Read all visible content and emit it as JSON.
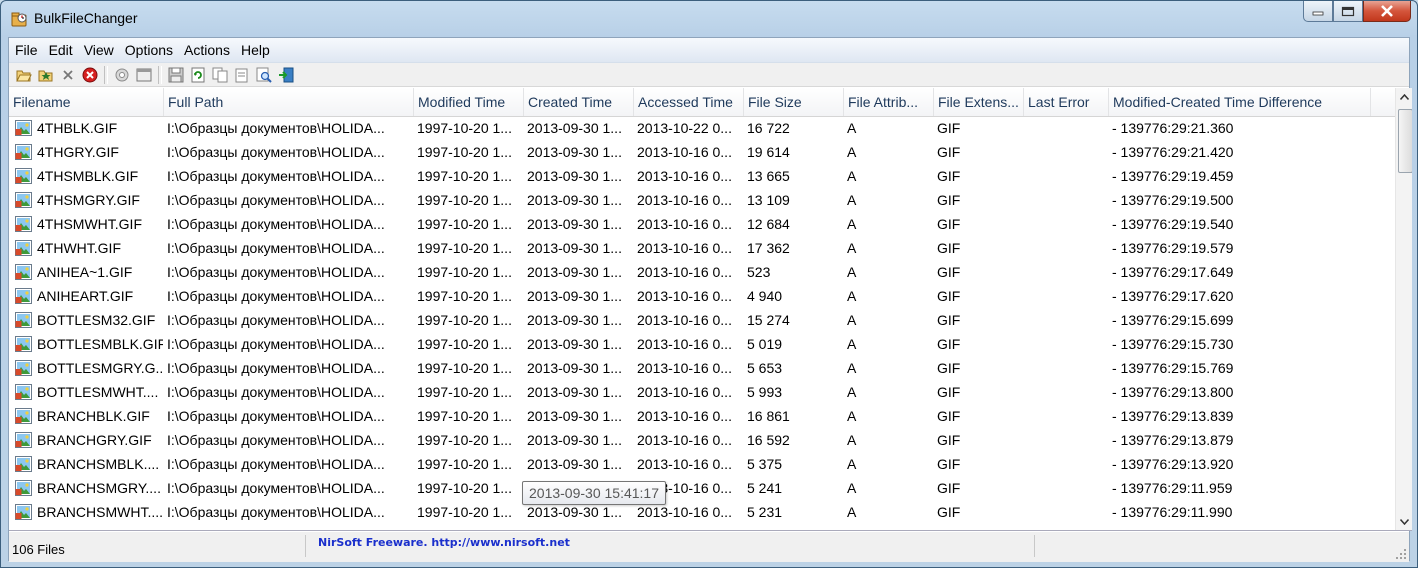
{
  "window": {
    "title": "BulkFileChanger"
  },
  "menu": [
    "File",
    "Edit",
    "View",
    "Options",
    "Actions",
    "Help"
  ],
  "toolbar_icons": [
    "open-folder-icon",
    "add-files-icon",
    "delete-icon",
    "stop-icon",
    "properties-icon",
    "window-icon",
    "save-icon",
    "refresh-icon",
    "copy-icon",
    "copy-html-icon",
    "find-icon",
    "exit-icon"
  ],
  "columns": [
    "Filename",
    "Full Path",
    "Modified Time",
    "Created Time",
    "Accessed Time",
    "File Size",
    "File Attrib...",
    "File Extens...",
    "Last Error",
    "Modified-Created Time Difference"
  ],
  "rows": [
    [
      "4THBLK.GIF",
      "I:\\Образцы документов\\HOLIDA...",
      "1997-10-20 1...",
      "2013-09-30 1...",
      "2013-10-22 0...",
      "16 722",
      "A",
      "GIF",
      "",
      "- 139776:29:21.360"
    ],
    [
      "4THGRY.GIF",
      "I:\\Образцы документов\\HOLIDA...",
      "1997-10-20 1...",
      "2013-09-30 1...",
      "2013-10-16 0...",
      "19 614",
      "A",
      "GIF",
      "",
      "- 139776:29:21.420"
    ],
    [
      "4THSMBLK.GIF",
      "I:\\Образцы документов\\HOLIDA...",
      "1997-10-20 1...",
      "2013-09-30 1...",
      "2013-10-16 0...",
      "13 665",
      "A",
      "GIF",
      "",
      "- 139776:29:19.459"
    ],
    [
      "4THSMGRY.GIF",
      "I:\\Образцы документов\\HOLIDA...",
      "1997-10-20 1...",
      "2013-09-30 1...",
      "2013-10-16 0...",
      "13 109",
      "A",
      "GIF",
      "",
      "- 139776:29:19.500"
    ],
    [
      "4THSMWHT.GIF",
      "I:\\Образцы документов\\HOLIDA...",
      "1997-10-20 1...",
      "2013-09-30 1...",
      "2013-10-16 0...",
      "12 684",
      "A",
      "GIF",
      "",
      "- 139776:29:19.540"
    ],
    [
      "4THWHT.GIF",
      "I:\\Образцы документов\\HOLIDA...",
      "1997-10-20 1...",
      "2013-09-30 1...",
      "2013-10-16 0...",
      "17 362",
      "A",
      "GIF",
      "",
      "- 139776:29:19.579"
    ],
    [
      "ANIHEA~1.GIF",
      "I:\\Образцы документов\\HOLIDA...",
      "1997-10-20 1...",
      "2013-09-30 1...",
      "2013-10-16 0...",
      "523",
      "A",
      "GIF",
      "",
      "- 139776:29:17.649"
    ],
    [
      "ANIHEART.GIF",
      "I:\\Образцы документов\\HOLIDA...",
      "1997-10-20 1...",
      "2013-09-30 1...",
      "2013-10-16 0...",
      "4 940",
      "A",
      "GIF",
      "",
      "- 139776:29:17.620"
    ],
    [
      "BOTTLESM32.GIF",
      "I:\\Образцы документов\\HOLIDA...",
      "1997-10-20 1...",
      "2013-09-30 1...",
      "2013-10-16 0...",
      "15 274",
      "A",
      "GIF",
      "",
      "- 139776:29:15.699"
    ],
    [
      "BOTTLESMBLK.GIF",
      "I:\\Образцы документов\\HOLIDA...",
      "1997-10-20 1...",
      "2013-09-30 1...",
      "2013-10-16 0...",
      "5 019",
      "A",
      "GIF",
      "",
      "- 139776:29:15.730"
    ],
    [
      "BOTTLESMGRY.G...",
      "I:\\Образцы документов\\HOLIDA...",
      "1997-10-20 1...",
      "2013-09-30 1...",
      "2013-10-16 0...",
      "5 653",
      "A",
      "GIF",
      "",
      "- 139776:29:15.769"
    ],
    [
      "BOTTLESMWHT....",
      "I:\\Образцы документов\\HOLIDA...",
      "1997-10-20 1...",
      "2013-09-30 1...",
      "2013-10-16 0...",
      "5 993",
      "A",
      "GIF",
      "",
      "- 139776:29:13.800"
    ],
    [
      "BRANCHBLK.GIF",
      "I:\\Образцы документов\\HOLIDA...",
      "1997-10-20 1...",
      "2013-09-30 1...",
      "2013-10-16 0...",
      "16 861",
      "A",
      "GIF",
      "",
      "- 139776:29:13.839"
    ],
    [
      "BRANCHGRY.GIF",
      "I:\\Образцы документов\\HOLIDA...",
      "1997-10-20 1...",
      "2013-09-30 1...",
      "2013-10-16 0...",
      "16 592",
      "A",
      "GIF",
      "",
      "- 139776:29:13.879"
    ],
    [
      "BRANCHSMBLK....",
      "I:\\Образцы документов\\HOLIDA...",
      "1997-10-20 1...",
      "2013-09-30 1...",
      "2013-10-16 0...",
      "5 375",
      "A",
      "GIF",
      "",
      "- 139776:29:13.920"
    ],
    [
      "BRANCHSMGRY....",
      "I:\\Образцы документов\\HOLIDA...",
      "1997-10-20 1...",
      "2013-09-30 1...",
      "2013-10-16 0...",
      "5 241",
      "A",
      "GIF",
      "",
      "- 139776:29:11.959"
    ],
    [
      "BRANCHSMWHT....",
      "I:\\Образцы документов\\HOLIDA...",
      "1997-10-20 1...",
      "2013-09-30 1...",
      "2013-10-16 0...",
      "5 231",
      "A",
      "GIF",
      "",
      "- 139776:29:11.990"
    ]
  ],
  "tooltip": "2013-09-30 15:41:17",
  "status": {
    "count": "106 Files",
    "link": "NirSoft Freeware.  http://www.nirsoft.net"
  },
  "colors": {
    "link": "#1a2fcc",
    "close_button": "#c83b1e",
    "header_text": "#1e395b"
  }
}
